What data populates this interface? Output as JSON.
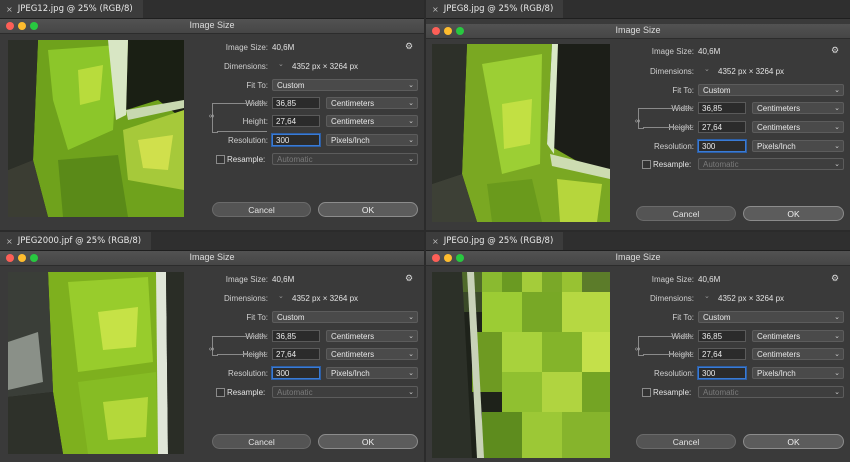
{
  "dialog_title": "Image Size",
  "labels": {
    "image_size": "Image Size:",
    "dimensions": "Dimensions:",
    "fit_to": "Fit To:",
    "width": "Width:",
    "height": "Height:",
    "resolution": "Resolution:",
    "resample": "Resample:"
  },
  "values": {
    "image_size": "40,6M",
    "dimensions": "4352 px  ×  3264 px",
    "fit_to": "Custom",
    "width": "36,85",
    "height": "27,64",
    "resolution": "300",
    "width_unit": "Centimeters",
    "height_unit": "Centimeters",
    "resolution_unit": "Pixels/Inch",
    "resample": "Automatic"
  },
  "buttons": {
    "cancel": "Cancel",
    "ok": "OK"
  },
  "icons": {
    "close": "×",
    "gear": "⚙",
    "chevron": "⌄"
  },
  "tabs": [
    {
      "label": "JPEG12.jpg @ 25% (RGB/8)"
    },
    {
      "label": "JPEG8.jpg @ 25% (RGB/8)"
    },
    {
      "label": "JPEG2000.jpf @ 25% (RGB/8)"
    },
    {
      "label": "JPEG0.jpg @ 25% (RGB/8)"
    }
  ],
  "colors": {
    "window_bg": "#3a3a3a",
    "traffic_red": "#fd5f57",
    "traffic_yellow": "#febc2e",
    "traffic_green": "#28c840",
    "focus_blue": "#3a7bd5"
  }
}
